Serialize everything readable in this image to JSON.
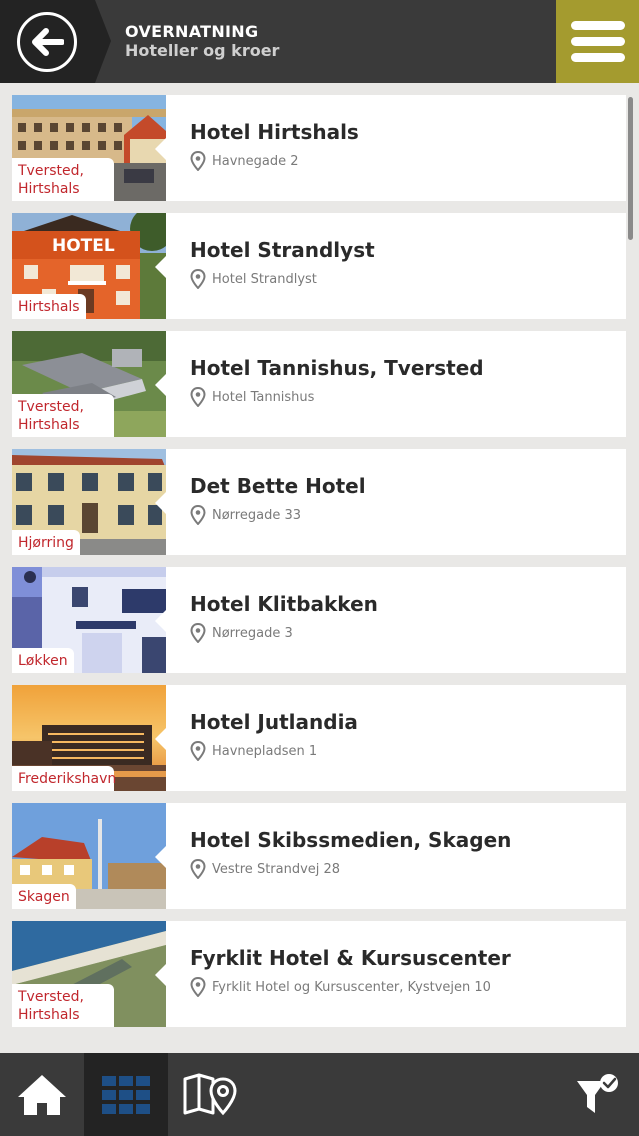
{
  "header": {
    "title": "OVERNATNING",
    "subtitle": "Hoteller og kroer",
    "accent_color": "#a49b2f",
    "back_icon": "arrow-left-circle-icon",
    "menu_icon": "hamburger-menu-icon"
  },
  "hotels": [
    {
      "name": "Hotel Hirtshals",
      "address": "Havnegade 2",
      "location": "Tversted, Hirtshals"
    },
    {
      "name": "Hotel Strandlyst",
      "address": "Hotel Strandlyst",
      "location": "Hirtshals",
      "sign": "HOTEL"
    },
    {
      "name": "Hotel Tannishus, Tversted",
      "address": "Hotel Tannishus",
      "location": "Tversted, Hirtshals"
    },
    {
      "name": "Det Bette Hotel",
      "address": "Nørregade 33",
      "location": "Hjørring"
    },
    {
      "name": "Hotel Klitbakken",
      "address": "Nørregade 3",
      "location": "Løkken"
    },
    {
      "name": "Hotel Jutlandia",
      "address": "Havnepladsen 1",
      "location": "Frederikshavn"
    },
    {
      "name": "Hotel Skibssmedien, Skagen",
      "address": "Vestre Strandvej 28",
      "location": "Skagen"
    },
    {
      "name": "Fyrklit Hotel & Kursuscenter",
      "address": "Fyrklit Hotel og Kursuscenter, Kystvejen 10",
      "location": "Tversted, Hirtshals"
    }
  ],
  "bottom_nav": {
    "tabs": [
      "home-icon",
      "grid-icon",
      "map-pin-icon"
    ],
    "active": "grid-icon",
    "filter_icon": "filter-check-icon",
    "active_color": "#1e4f86"
  }
}
